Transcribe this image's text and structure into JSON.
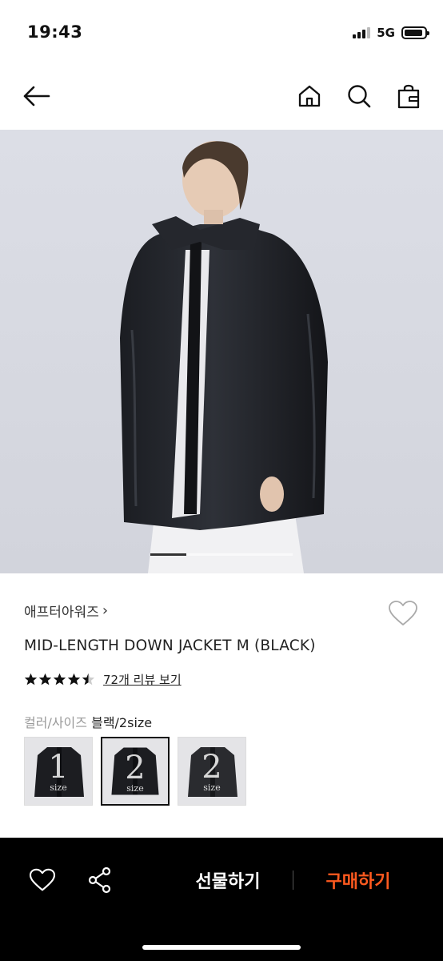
{
  "status_bar": {
    "time": "19:43",
    "network": "5G",
    "battery_level": 0.9
  },
  "nav": {
    "back_icon": "arrow-left-icon",
    "home_icon": "home-icon",
    "search_icon": "search-icon",
    "bag_icon": "shopping-bag-icon"
  },
  "gallery": {
    "current_index": 1,
    "indicator_fraction": 0.25
  },
  "product": {
    "brand": "애프터아워즈",
    "brand_chevron": "›",
    "title": "MID-LENGTH DOWN JACKET M (BLACK)",
    "rating": 4.5,
    "review_link": "72개 리뷰 보기"
  },
  "options": {
    "label": "컬러/사이즈",
    "selected_value": "블랙/2size",
    "swatches": [
      {
        "number": "1",
        "size_text": "size",
        "selected": false
      },
      {
        "number": "2",
        "size_text": "size",
        "selected": true
      },
      {
        "number": "2",
        "size_text": "size",
        "selected": false
      }
    ]
  },
  "bottom_bar": {
    "heart_icon": "heart-outline-icon",
    "share_icon": "share-icon",
    "gift_label": "선물하기",
    "buy_label": "구매하기"
  },
  "colors": {
    "accent_buy": "#ff5a1f",
    "bottom_bar_bg": "#000000",
    "hero_bg": "#d9dbe3"
  }
}
